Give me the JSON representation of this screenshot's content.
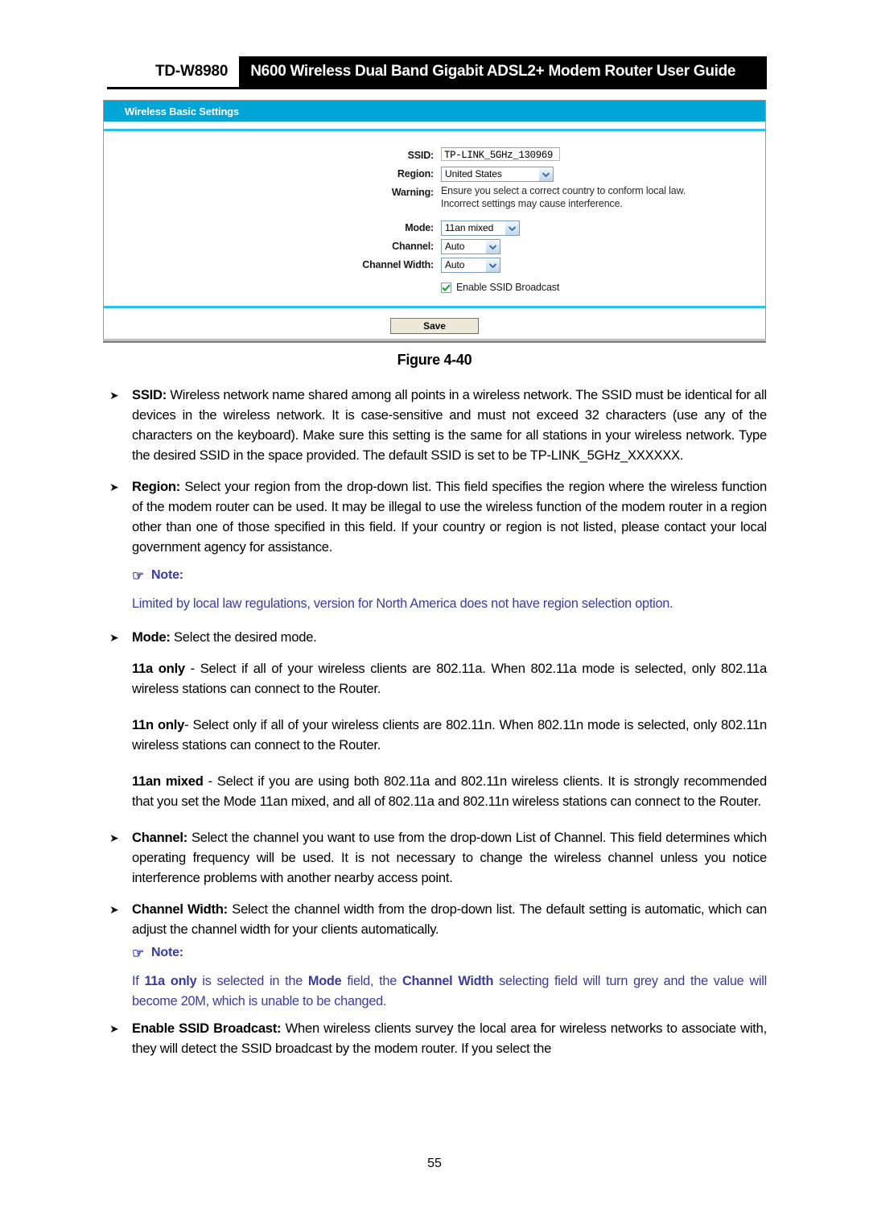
{
  "header": {
    "model": "TD-W8980",
    "title": "N600 Wireless Dual Band Gigabit ADSL2+ Modem Router User Guide"
  },
  "panel": {
    "title": "Wireless Basic Settings",
    "fields": {
      "ssid_label": "SSID:",
      "ssid_value": "TP-LINK_5GHz_130969",
      "region_label": "Region:",
      "region_value": "United States",
      "warning_label": "Warning:",
      "warning_line1": "Ensure you select a correct country to conform local law.",
      "warning_line2": "Incorrect settings may cause interference.",
      "mode_label": "Mode:",
      "mode_value": "11an mixed",
      "channel_label": "Channel:",
      "channel_value": "Auto",
      "channel_width_label": "Channel Width:",
      "channel_width_value": "Auto",
      "broadcast_label": "Enable SSID Broadcast",
      "broadcast_checked": true
    },
    "save_label": "Save",
    "accent_color": "#00a5d8",
    "divider_color": "#2cc0ea"
  },
  "figure_caption": "Figure 4-40",
  "content": {
    "ssid": {
      "term": "SSID:",
      "body": " Wireless network name shared among all points in a wireless network. The SSID must be identical for all devices in the wireless network. It is case-sensitive and must not exceed 32 characters (use any of the characters on the keyboard). Make sure this setting is the same for all stations in your wireless network. Type the desired SSID in the space provided. The default SSID is set to be TP-LINK_5GHz_XXXXXX."
    },
    "region": {
      "term": "Region:",
      "body": " Select your region from the drop-down list. This field specifies the region where the wireless function of the modem router can be used. It may be illegal to use the wireless function of the modem router in a region other than one of those specified in this field. If your country or region is not listed, please contact your local government agency for assistance."
    },
    "note1": {
      "head": "Note:",
      "hand_icon": "pointing-hand-icon",
      "text": "Limited by local law regulations, version for North America does not have region selection option."
    },
    "mode": {
      "term": "Mode:",
      "body": " Select the desired mode."
    },
    "mode_11a": {
      "term": "11a only",
      "body": " - Select if all of your wireless clients are 802.11a. When 802.11a mode is selected, only 802.11a wireless stations can connect to the Router."
    },
    "mode_11n": {
      "term": "11n only",
      "body": "- Select only if all of your wireless clients are 802.11n. When 802.11n mode is selected, only 802.11n wireless stations can connect to the Router."
    },
    "mode_11an": {
      "term": "11an mixed",
      "body": " - Select if you are using both 802.11a and 802.11n wireless clients. It is strongly recommended that you set the Mode 11an mixed, and all of 802.11a and 802.11n wireless stations can connect to the Router."
    },
    "channel": {
      "term": "Channel:",
      "body": " Select the channel you want to use from the drop-down List of Channel. This field determines which operating frequency will be used. It is not necessary to change the wireless channel unless you notice interference problems with another nearby access point."
    },
    "channel_width": {
      "term": "Channel Width:",
      "body": " Select the channel width from the drop-down list. The default setting is automatic, which can adjust the channel width for your clients automatically."
    },
    "note2": {
      "head": "Note:",
      "hand_icon": "pointing-hand-icon",
      "prefix": "If ",
      "b1": "11a only",
      "mid1": " is selected in the ",
      "b2": "Mode",
      "mid2": " field, the ",
      "b3": "Channel Width",
      "suffix": " selecting field will turn grey and the value will become 20M, which is unable to be changed."
    },
    "broadcast": {
      "term": "Enable SSID Broadcast:",
      "body": " When wireless clients survey the local area for wireless networks to associate with, they will detect the SSID broadcast by the modem router. If you select the"
    }
  },
  "page_number": "55",
  "bullet_glyph": "➤"
}
